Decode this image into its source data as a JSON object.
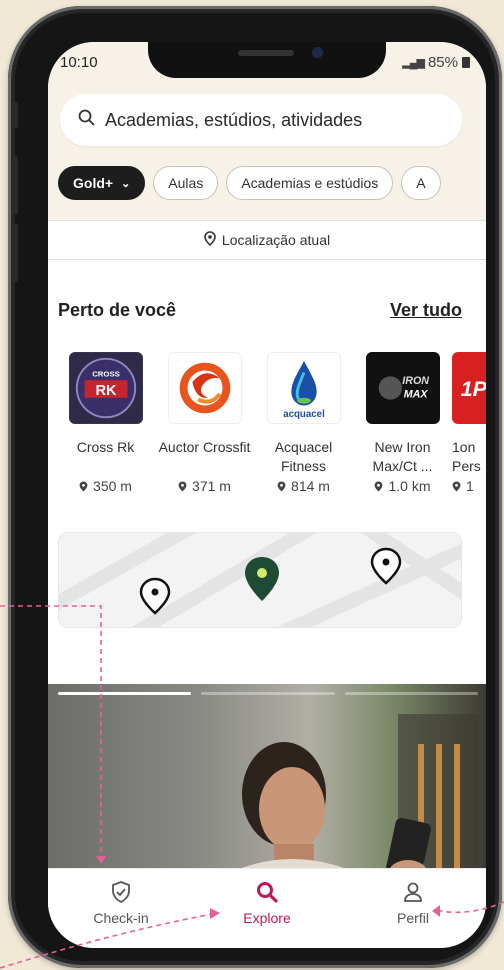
{
  "status": {
    "time": "10:10",
    "battery": "85%"
  },
  "search": {
    "placeholder": "Academias, estúdios, atividades"
  },
  "filters": [
    {
      "label": "Gold+"
    },
    {
      "label": "Aulas"
    },
    {
      "label": "Academias e estúdios"
    },
    {
      "label": "A"
    }
  ],
  "location": {
    "label": "Localização atual"
  },
  "nearby": {
    "title": "Perto de você",
    "see_all": "Ver tudo",
    "gyms": [
      {
        "name": "Cross Rk",
        "distance": "350 m"
      },
      {
        "name": "Auctor Crossfit",
        "distance": "371 m"
      },
      {
        "name": "Acquacel Fitness",
        "distance": "814 m"
      },
      {
        "name": "New Iron Max/Ct ...",
        "distance": "1.0 km"
      },
      {
        "name": "1on Pers",
        "distance": "1"
      }
    ]
  },
  "nav": {
    "checkin": "Check-in",
    "explore": "Explore",
    "profile": "Perfil"
  },
  "colors": {
    "accent": "#c0185a",
    "pin": "#1f4a35",
    "frame_bg": "#f1e8d6"
  }
}
